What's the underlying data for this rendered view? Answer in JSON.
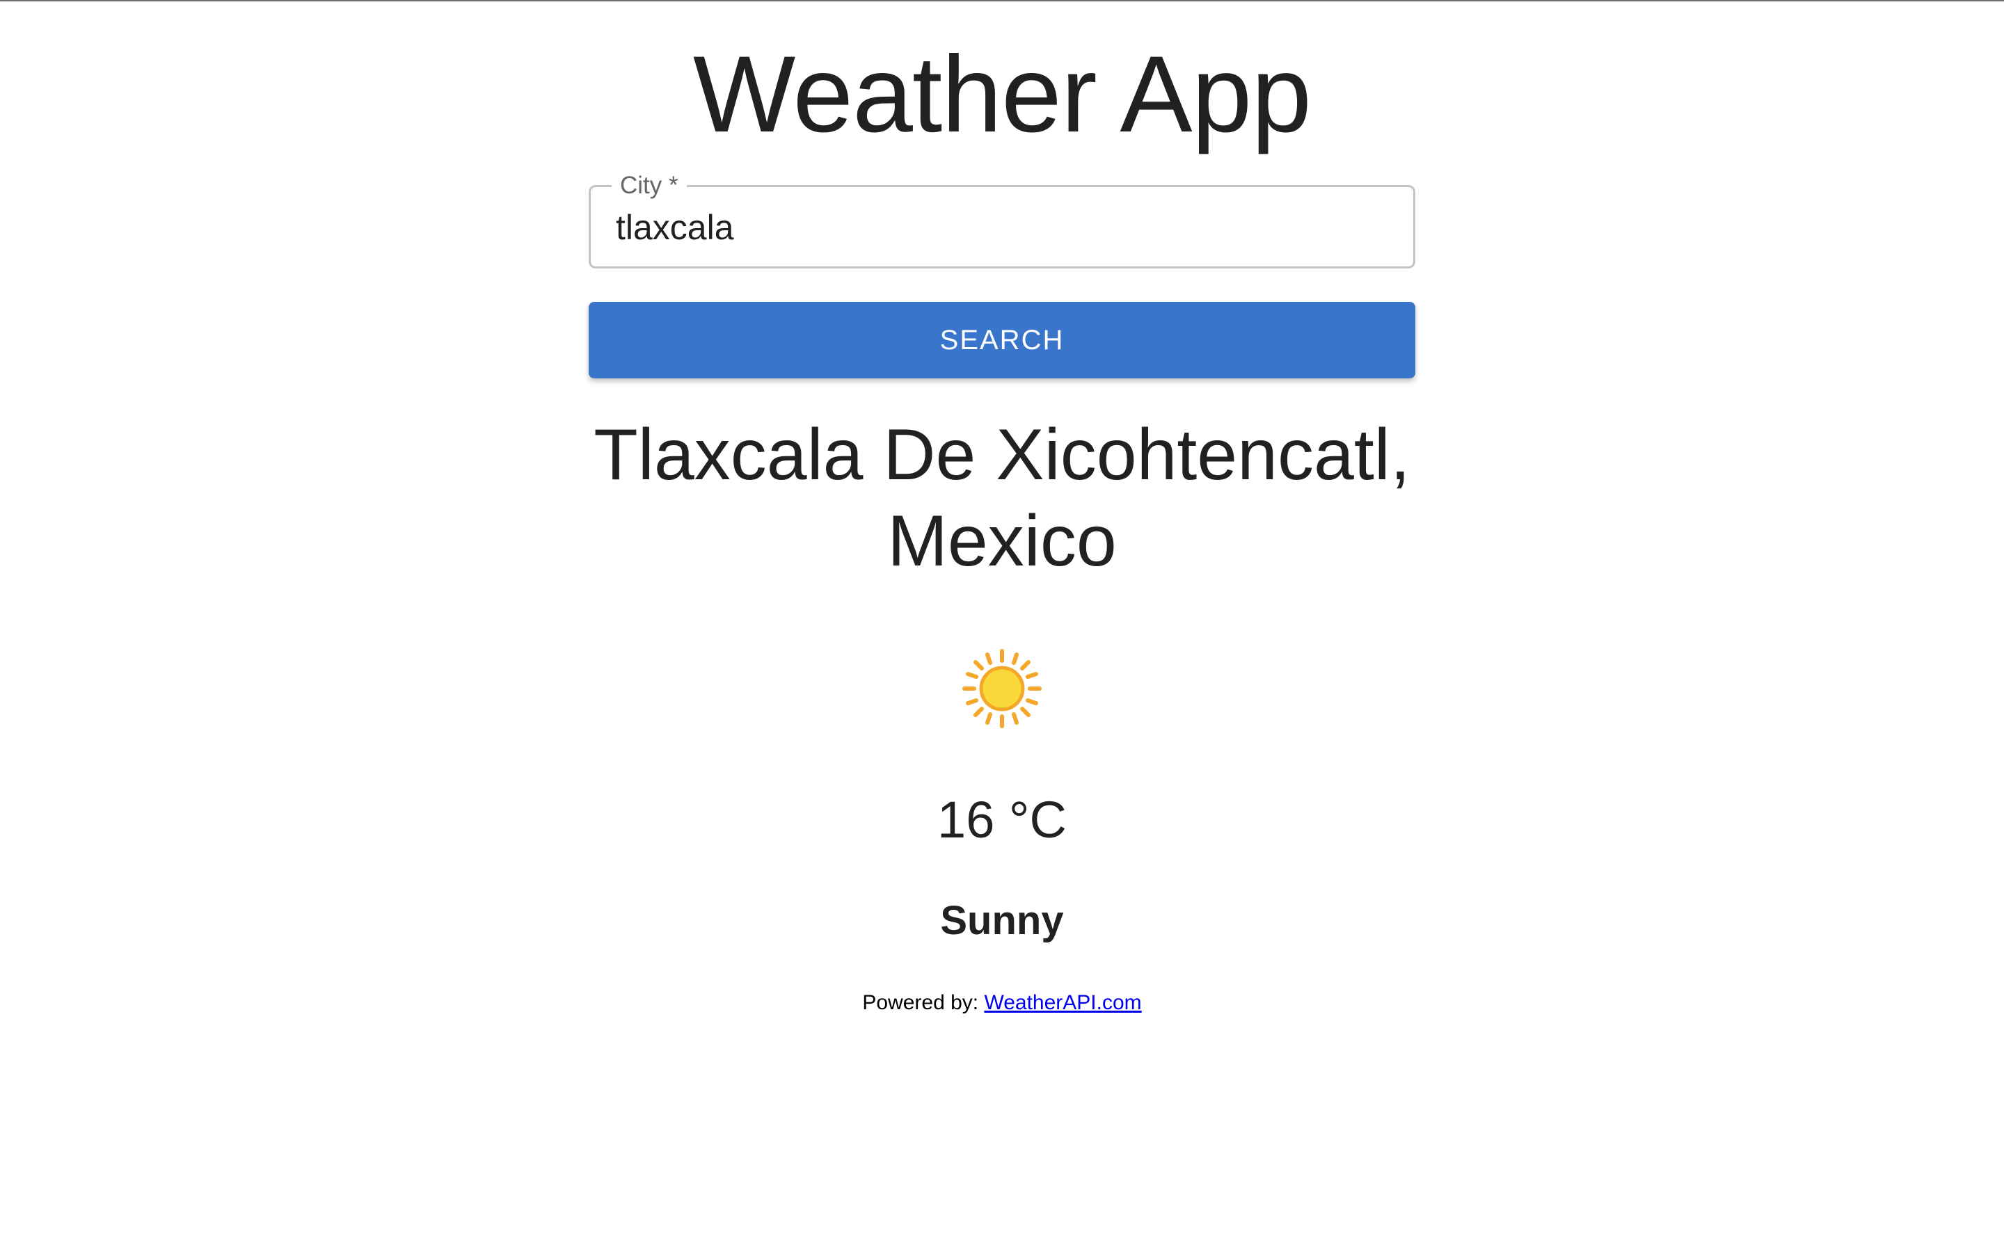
{
  "app": {
    "title": "Weather App"
  },
  "search": {
    "field_label": "City *",
    "value": "tlaxcala",
    "button_label": "SEARCH"
  },
  "result": {
    "location": "Tlaxcala De Xicohtencatl, Mexico",
    "icon": "sun-icon",
    "temperature": "16 °C",
    "condition": "Sunny"
  },
  "footer": {
    "powered_label": "Powered by:",
    "link_text": "WeatherAPI.com"
  },
  "colors": {
    "button": "#3a75cc",
    "link": "#0000ee",
    "sun_core": "#f9d93a",
    "sun_rays": "#f4a72a"
  }
}
